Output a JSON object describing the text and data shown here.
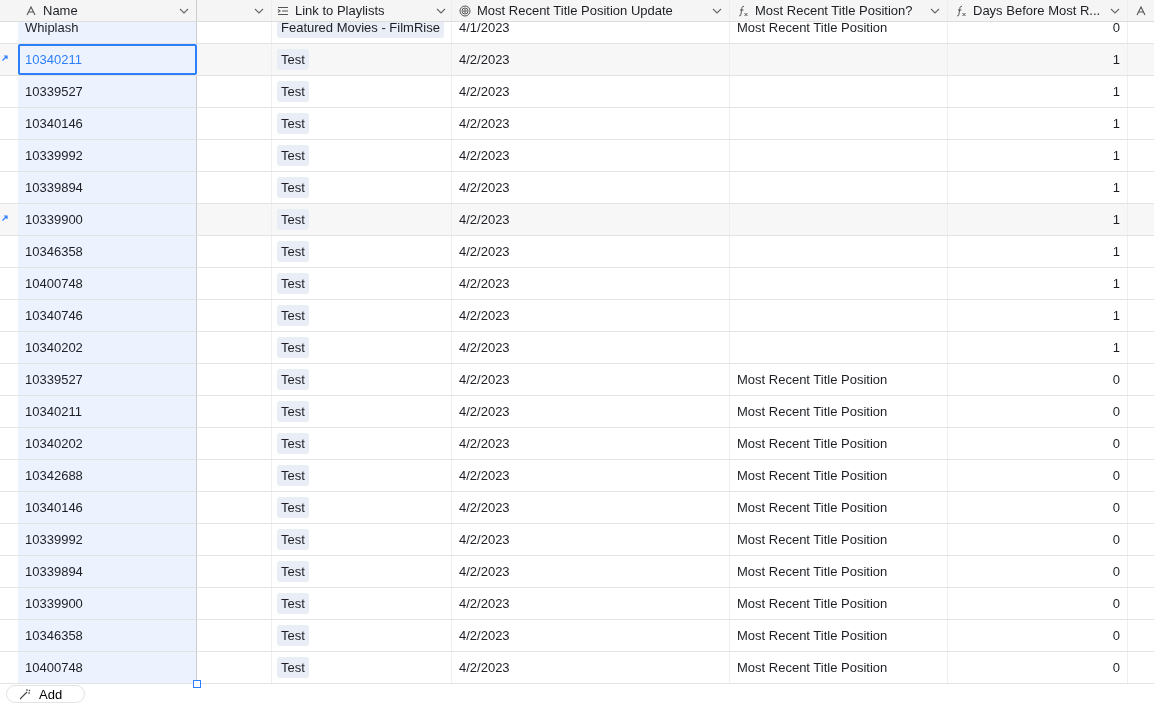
{
  "columns": [
    {
      "label": "Name",
      "kind": "text"
    },
    {
      "kind": "blank"
    },
    {
      "label": "Link to Playlists",
      "kind": "link"
    },
    {
      "label": "Most Recent Title Position Update",
      "kind": "rollup"
    },
    {
      "label": "Most Recent Title Position?",
      "kind": "formula"
    },
    {
      "label": "Days Before Most R...",
      "kind": "formula"
    },
    {
      "kind": "text-partial"
    }
  ],
  "rows": [
    {
      "name": "Whiplash",
      "playlist": "Featured Movies - FilmRise",
      "date": "4/1/2023",
      "position": "Most Recent Title Position",
      "days": "0",
      "highlighted": false,
      "selected": false
    },
    {
      "name": "10340211",
      "playlist": "Test",
      "date": "4/2/2023",
      "position": "",
      "days": "1",
      "highlighted": true,
      "selected": true
    },
    {
      "name": "10339527",
      "playlist": "Test",
      "date": "4/2/2023",
      "position": "",
      "days": "1",
      "highlighted": false,
      "selected": false
    },
    {
      "name": "10340146",
      "playlist": "Test",
      "date": "4/2/2023",
      "position": "",
      "days": "1",
      "highlighted": false,
      "selected": false
    },
    {
      "name": "10339992",
      "playlist": "Test",
      "date": "4/2/2023",
      "position": "",
      "days": "1",
      "highlighted": false,
      "selected": false
    },
    {
      "name": "10339894",
      "playlist": "Test",
      "date": "4/2/2023",
      "position": "",
      "days": "1",
      "highlighted": false,
      "selected": false
    },
    {
      "name": "10339900",
      "playlist": "Test",
      "date": "4/2/2023",
      "position": "",
      "days": "1",
      "highlighted": true,
      "selected": false
    },
    {
      "name": "10346358",
      "playlist": "Test",
      "date": "4/2/2023",
      "position": "",
      "days": "1",
      "highlighted": false,
      "selected": false
    },
    {
      "name": "10400748",
      "playlist": "Test",
      "date": "4/2/2023",
      "position": "",
      "days": "1",
      "highlighted": false,
      "selected": false
    },
    {
      "name": "10340746",
      "playlist": "Test",
      "date": "4/2/2023",
      "position": "",
      "days": "1",
      "highlighted": false,
      "selected": false
    },
    {
      "name": "10340202",
      "playlist": "Test",
      "date": "4/2/2023",
      "position": "",
      "days": "1",
      "highlighted": false,
      "selected": false
    },
    {
      "name": "10339527",
      "playlist": "Test",
      "date": "4/2/2023",
      "position": "Most Recent Title Position",
      "days": "0",
      "highlighted": false,
      "selected": false
    },
    {
      "name": "10340211",
      "playlist": "Test",
      "date": "4/2/2023",
      "position": "Most Recent Title Position",
      "days": "0",
      "highlighted": false,
      "selected": false
    },
    {
      "name": "10340202",
      "playlist": "Test",
      "date": "4/2/2023",
      "position": "Most Recent Title Position",
      "days": "0",
      "highlighted": false,
      "selected": false
    },
    {
      "name": "10342688",
      "playlist": "Test",
      "date": "4/2/2023",
      "position": "Most Recent Title Position",
      "days": "0",
      "highlighted": false,
      "selected": false
    },
    {
      "name": "10340146",
      "playlist": "Test",
      "date": "4/2/2023",
      "position": "Most Recent Title Position",
      "days": "0",
      "highlighted": false,
      "selected": false
    },
    {
      "name": "10339992",
      "playlist": "Test",
      "date": "4/2/2023",
      "position": "Most Recent Title Position",
      "days": "0",
      "highlighted": false,
      "selected": false
    },
    {
      "name": "10339894",
      "playlist": "Test",
      "date": "4/2/2023",
      "position": "Most Recent Title Position",
      "days": "0",
      "highlighted": false,
      "selected": false
    },
    {
      "name": "10339900",
      "playlist": "Test",
      "date": "4/2/2023",
      "position": "Most Recent Title Position",
      "days": "0",
      "highlighted": false,
      "selected": false
    },
    {
      "name": "10346358",
      "playlist": "Test",
      "date": "4/2/2023",
      "position": "Most Recent Title Position",
      "days": "0",
      "highlighted": false,
      "selected": false
    },
    {
      "name": "10400748",
      "playlist": "Test",
      "date": "4/2/2023",
      "position": "Most Recent Title Position",
      "days": "0",
      "highlighted": false,
      "selected": false
    }
  ],
  "add_button": {
    "label": "Add"
  }
}
